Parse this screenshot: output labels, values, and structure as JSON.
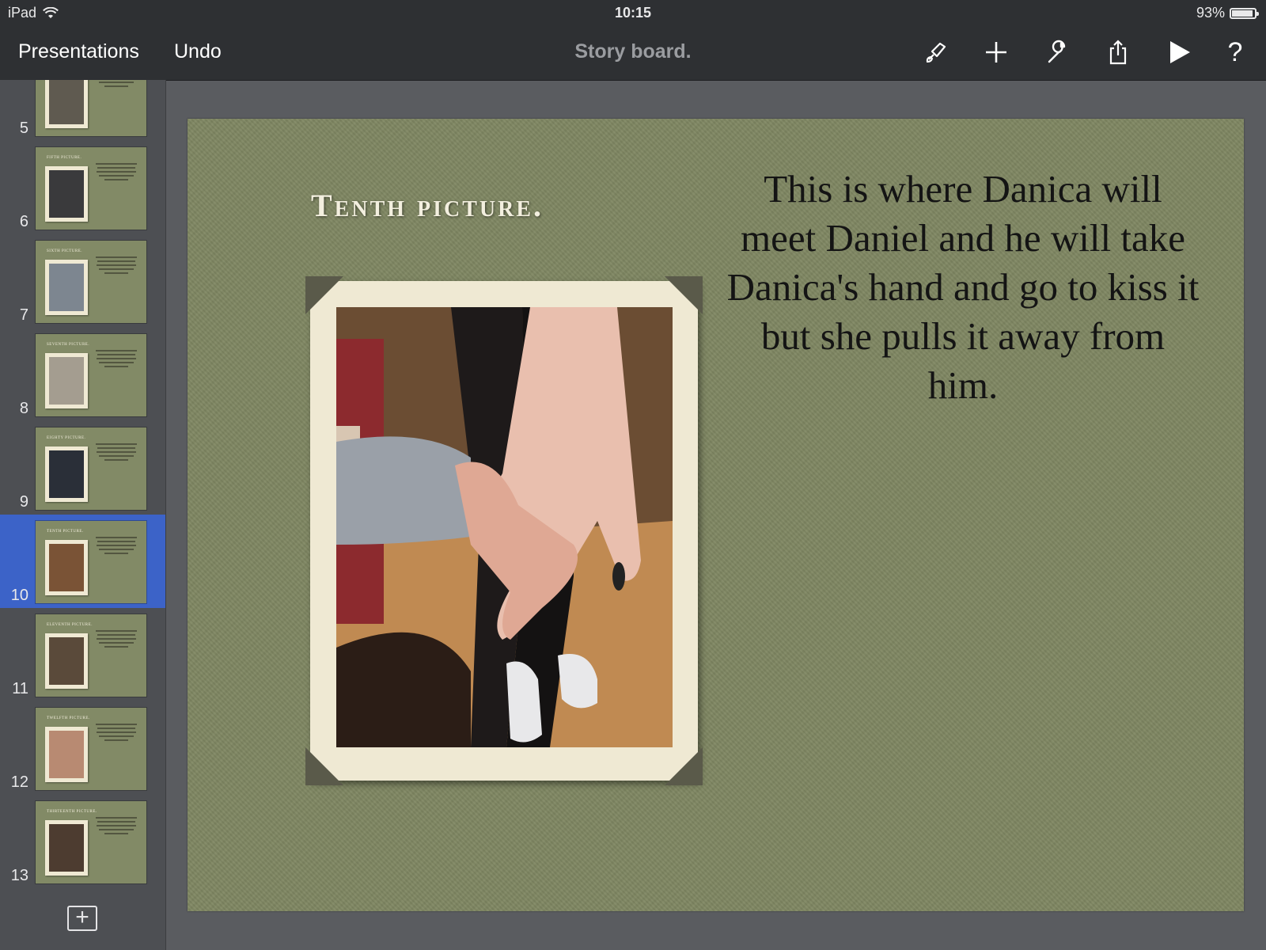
{
  "status_bar": {
    "device": "iPad",
    "time": "10:15",
    "battery": "93%",
    "battery_level": 0.93
  },
  "toolbar": {
    "presentations_label": "Presentations",
    "undo_label": "Undo",
    "document_title": "Story board.",
    "icons": [
      "paintbrush-icon",
      "plus-icon",
      "wrench-icon",
      "share-icon",
      "play-icon",
      "help-icon"
    ],
    "help_glyph": "?"
  },
  "sidebar": {
    "selected_number": "10",
    "slides": [
      {
        "number": "5",
        "title": "",
        "photo_color": "#5f5a50"
      },
      {
        "number": "6",
        "title": "Fifth picture.",
        "photo_color": "#3a3a3c"
      },
      {
        "number": "7",
        "title": "Sixth picture.",
        "photo_color": "#7d8690"
      },
      {
        "number": "8",
        "title": "Seventh picture.",
        "photo_color": "#a49d90"
      },
      {
        "number": "9",
        "title": "Eighty picture.",
        "photo_color": "#2a2f38"
      },
      {
        "number": "10",
        "title": "Tenth picture.",
        "photo_color": "#7a5336"
      },
      {
        "number": "11",
        "title": "Eleventh picture.",
        "photo_color": "#5a4a3a"
      },
      {
        "number": "12",
        "title": "Twelfth picture.",
        "photo_color": "#b88a72"
      },
      {
        "number": "13",
        "title": "Thirteenth picture.",
        "photo_color": "#4d3c30"
      }
    ]
  },
  "slide": {
    "title": "Tenth picture.",
    "body": "This is where Danica will meet Daniel and he will take Danica's hand and go to kiss it but she pulls it away from him."
  }
}
